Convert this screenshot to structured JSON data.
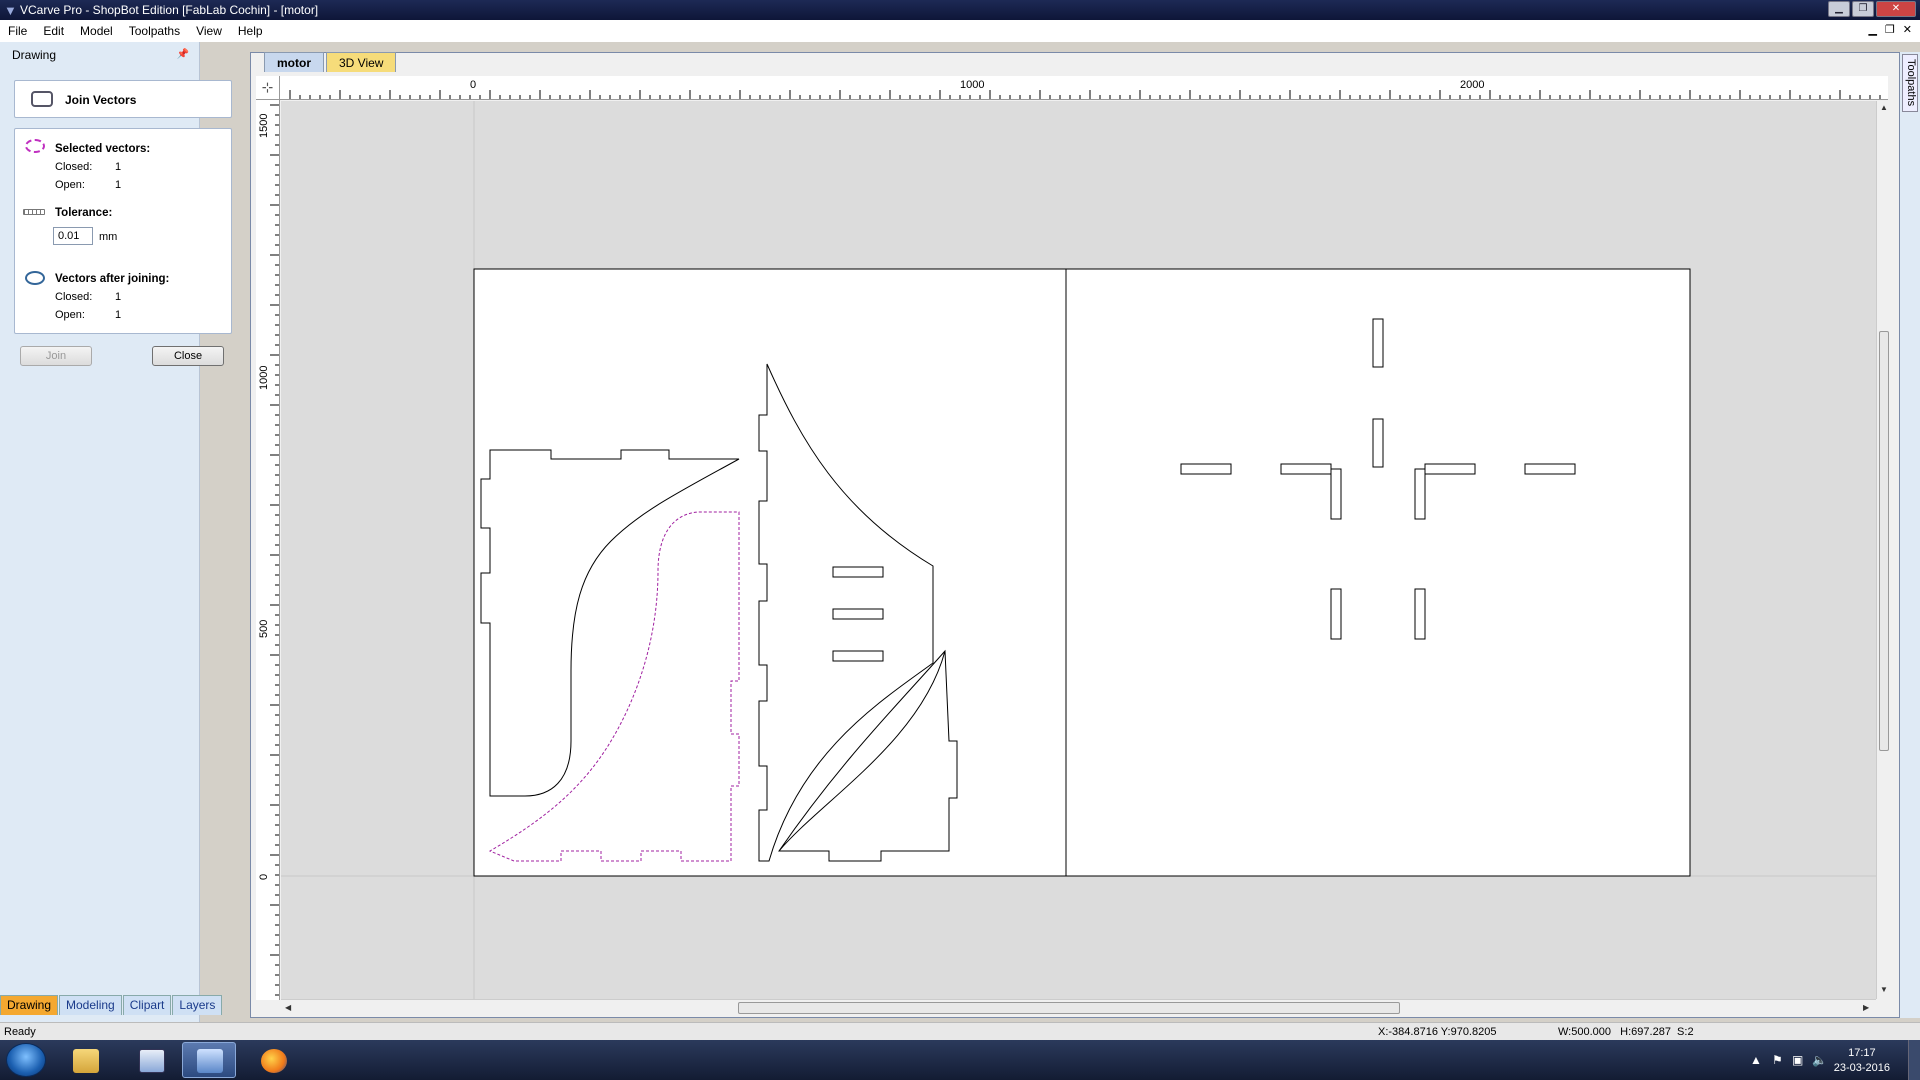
{
  "window": {
    "title": "VCarve Pro - ShopBot Edition [FabLab Cochin] - [motor]"
  },
  "menu": [
    "File",
    "Edit",
    "Model",
    "Toolpaths",
    "View",
    "Help"
  ],
  "left_panel": {
    "header": "Drawing",
    "tool_title": "Join Vectors",
    "selected": {
      "label": "Selected vectors:",
      "closed_label": "Closed:",
      "closed": "1",
      "open_label": "Open:",
      "open": "1"
    },
    "tolerance": {
      "label": "Tolerance:",
      "value": "0.01",
      "unit": "mm"
    },
    "after": {
      "label": "Vectors after joining:",
      "closed_label": "Closed:",
      "closed": "1",
      "open_label": "Open:",
      "open": "1"
    },
    "join_button": "Join",
    "close_button": "Close",
    "bottom_tabs": [
      "Drawing",
      "Modeling",
      "Clipart",
      "Layers"
    ]
  },
  "doc_tabs": [
    "motor",
    "3D View"
  ],
  "ruler": {
    "top_labels": [
      "0",
      "1000",
      "2000"
    ],
    "left_labels": [
      "1500",
      "1000",
      "500",
      "0"
    ]
  },
  "right_strip": {
    "tab": "Toolpaths"
  },
  "status": {
    "text": "Ready",
    "coords": "X:-384.8716 Y:970.8205",
    "dims": "W:500.000   H:697.287  S:2"
  },
  "taskbar": {
    "time": "17:17",
    "date": "23-03-2016"
  }
}
